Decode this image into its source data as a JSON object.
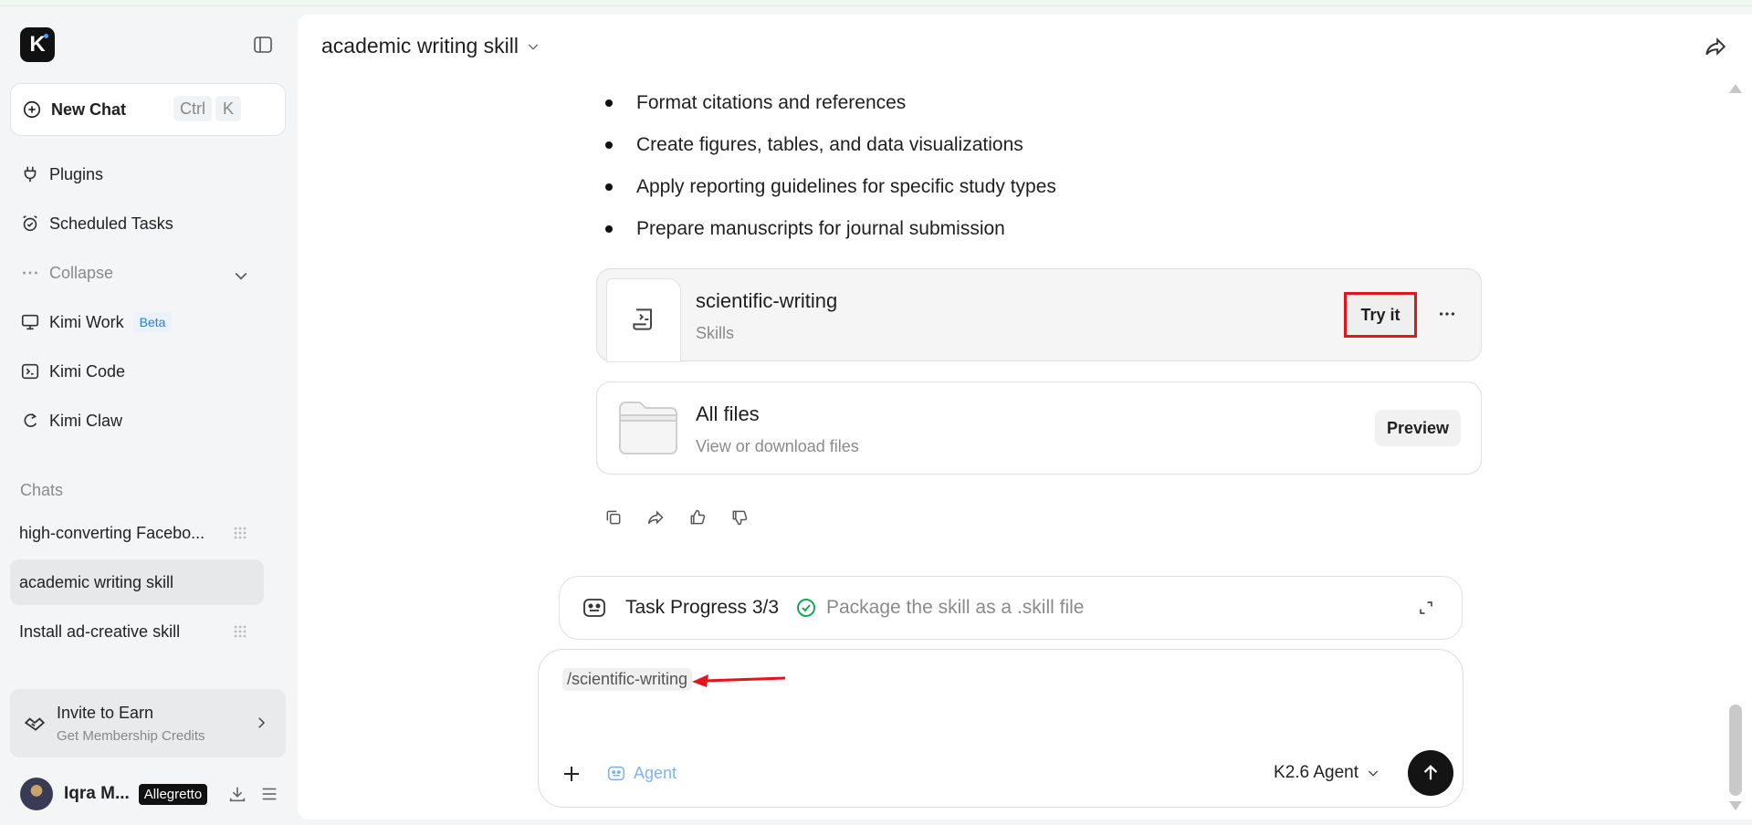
{
  "sidebar": {
    "logo_letter": "K",
    "new_chat": {
      "label": "New Chat",
      "key1": "Ctrl",
      "key2": "K"
    },
    "nav": {
      "plugins": "Plugins",
      "scheduled": "Scheduled Tasks",
      "collapse": "Collapse",
      "kimi_work": "Kimi Work",
      "kimi_work_badge": "Beta",
      "kimi_code": "Kimi Code",
      "kimi_claw": "Kimi Claw"
    },
    "chats_title": "Chats",
    "chats": [
      {
        "title": "high-converting Facebo..."
      },
      {
        "title": "academic writing skill"
      },
      {
        "title": "Install ad-creative skill"
      }
    ],
    "invite": {
      "title": "Invite to Earn",
      "subtitle": "Get Membership Credits"
    },
    "user": {
      "name": "Iqra M...",
      "plan": "Allegretto"
    }
  },
  "header": {
    "title": "academic writing skill"
  },
  "message": {
    "bullets": [
      "Format citations and references",
      "Create figures, tables, and data visualizations",
      "Apply reporting guidelines for specific study types",
      "Prepare manuscripts for journal submission"
    ],
    "skill_card": {
      "name": "scientific-writing",
      "type": "Skills",
      "action": "Try it"
    },
    "files_card": {
      "name": "All files",
      "description": "View or download files",
      "action": "Preview"
    }
  },
  "task_progress": {
    "label": "Task Progress 3/3",
    "step": "Package the skill as a .skill file"
  },
  "composer": {
    "command_chip": "/scientific-writing",
    "agent_label": "Agent",
    "model": "K2.6 Agent"
  },
  "colors": {
    "highlight_red": "#e3151b",
    "check_green": "#1aa55a",
    "agent_blue": "#7fb3f0"
  },
  "icons": [
    "plus-circle-icon",
    "sidebar-toggle-icon",
    "plug-icon",
    "alarm-clock-icon",
    "ellipsis-icon",
    "monitor-icon",
    "terminal-icon",
    "claw-icon",
    "grip-icon",
    "handshake-icon",
    "download-icon",
    "menu-icon",
    "share-icon",
    "scroll-icon",
    "folder-icon",
    "copy-icon",
    "thumbs-up-icon",
    "thumbs-down-icon",
    "robot-icon",
    "check-circle-icon",
    "expand-icon",
    "arrow-up-icon"
  ]
}
